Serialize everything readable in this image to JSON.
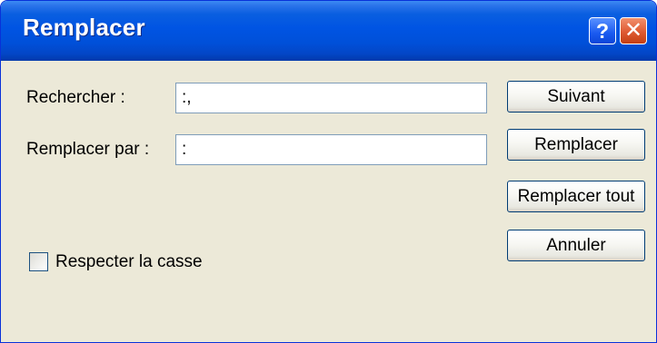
{
  "dialog": {
    "title": "Remplacer",
    "help_icon": "question-mark-icon",
    "close_icon": "close-x-icon",
    "help_glyph": "?",
    "close_glyph": "✕"
  },
  "form": {
    "find_label": "Rechercher :",
    "find_value": ":,",
    "replace_label": "Remplacer par :",
    "replace_value": ":",
    "match_case_label": "Respecter la casse",
    "match_case_checked": false
  },
  "buttons": {
    "next": "Suivant",
    "replace": "Remplacer",
    "replace_all": "Remplacer tout",
    "cancel": "Annuler"
  },
  "colors": {
    "titlebar": "#0054e3",
    "window_bg": "#ece9d8",
    "close_button": "#df5a32",
    "help_button": "#1a5af0"
  }
}
